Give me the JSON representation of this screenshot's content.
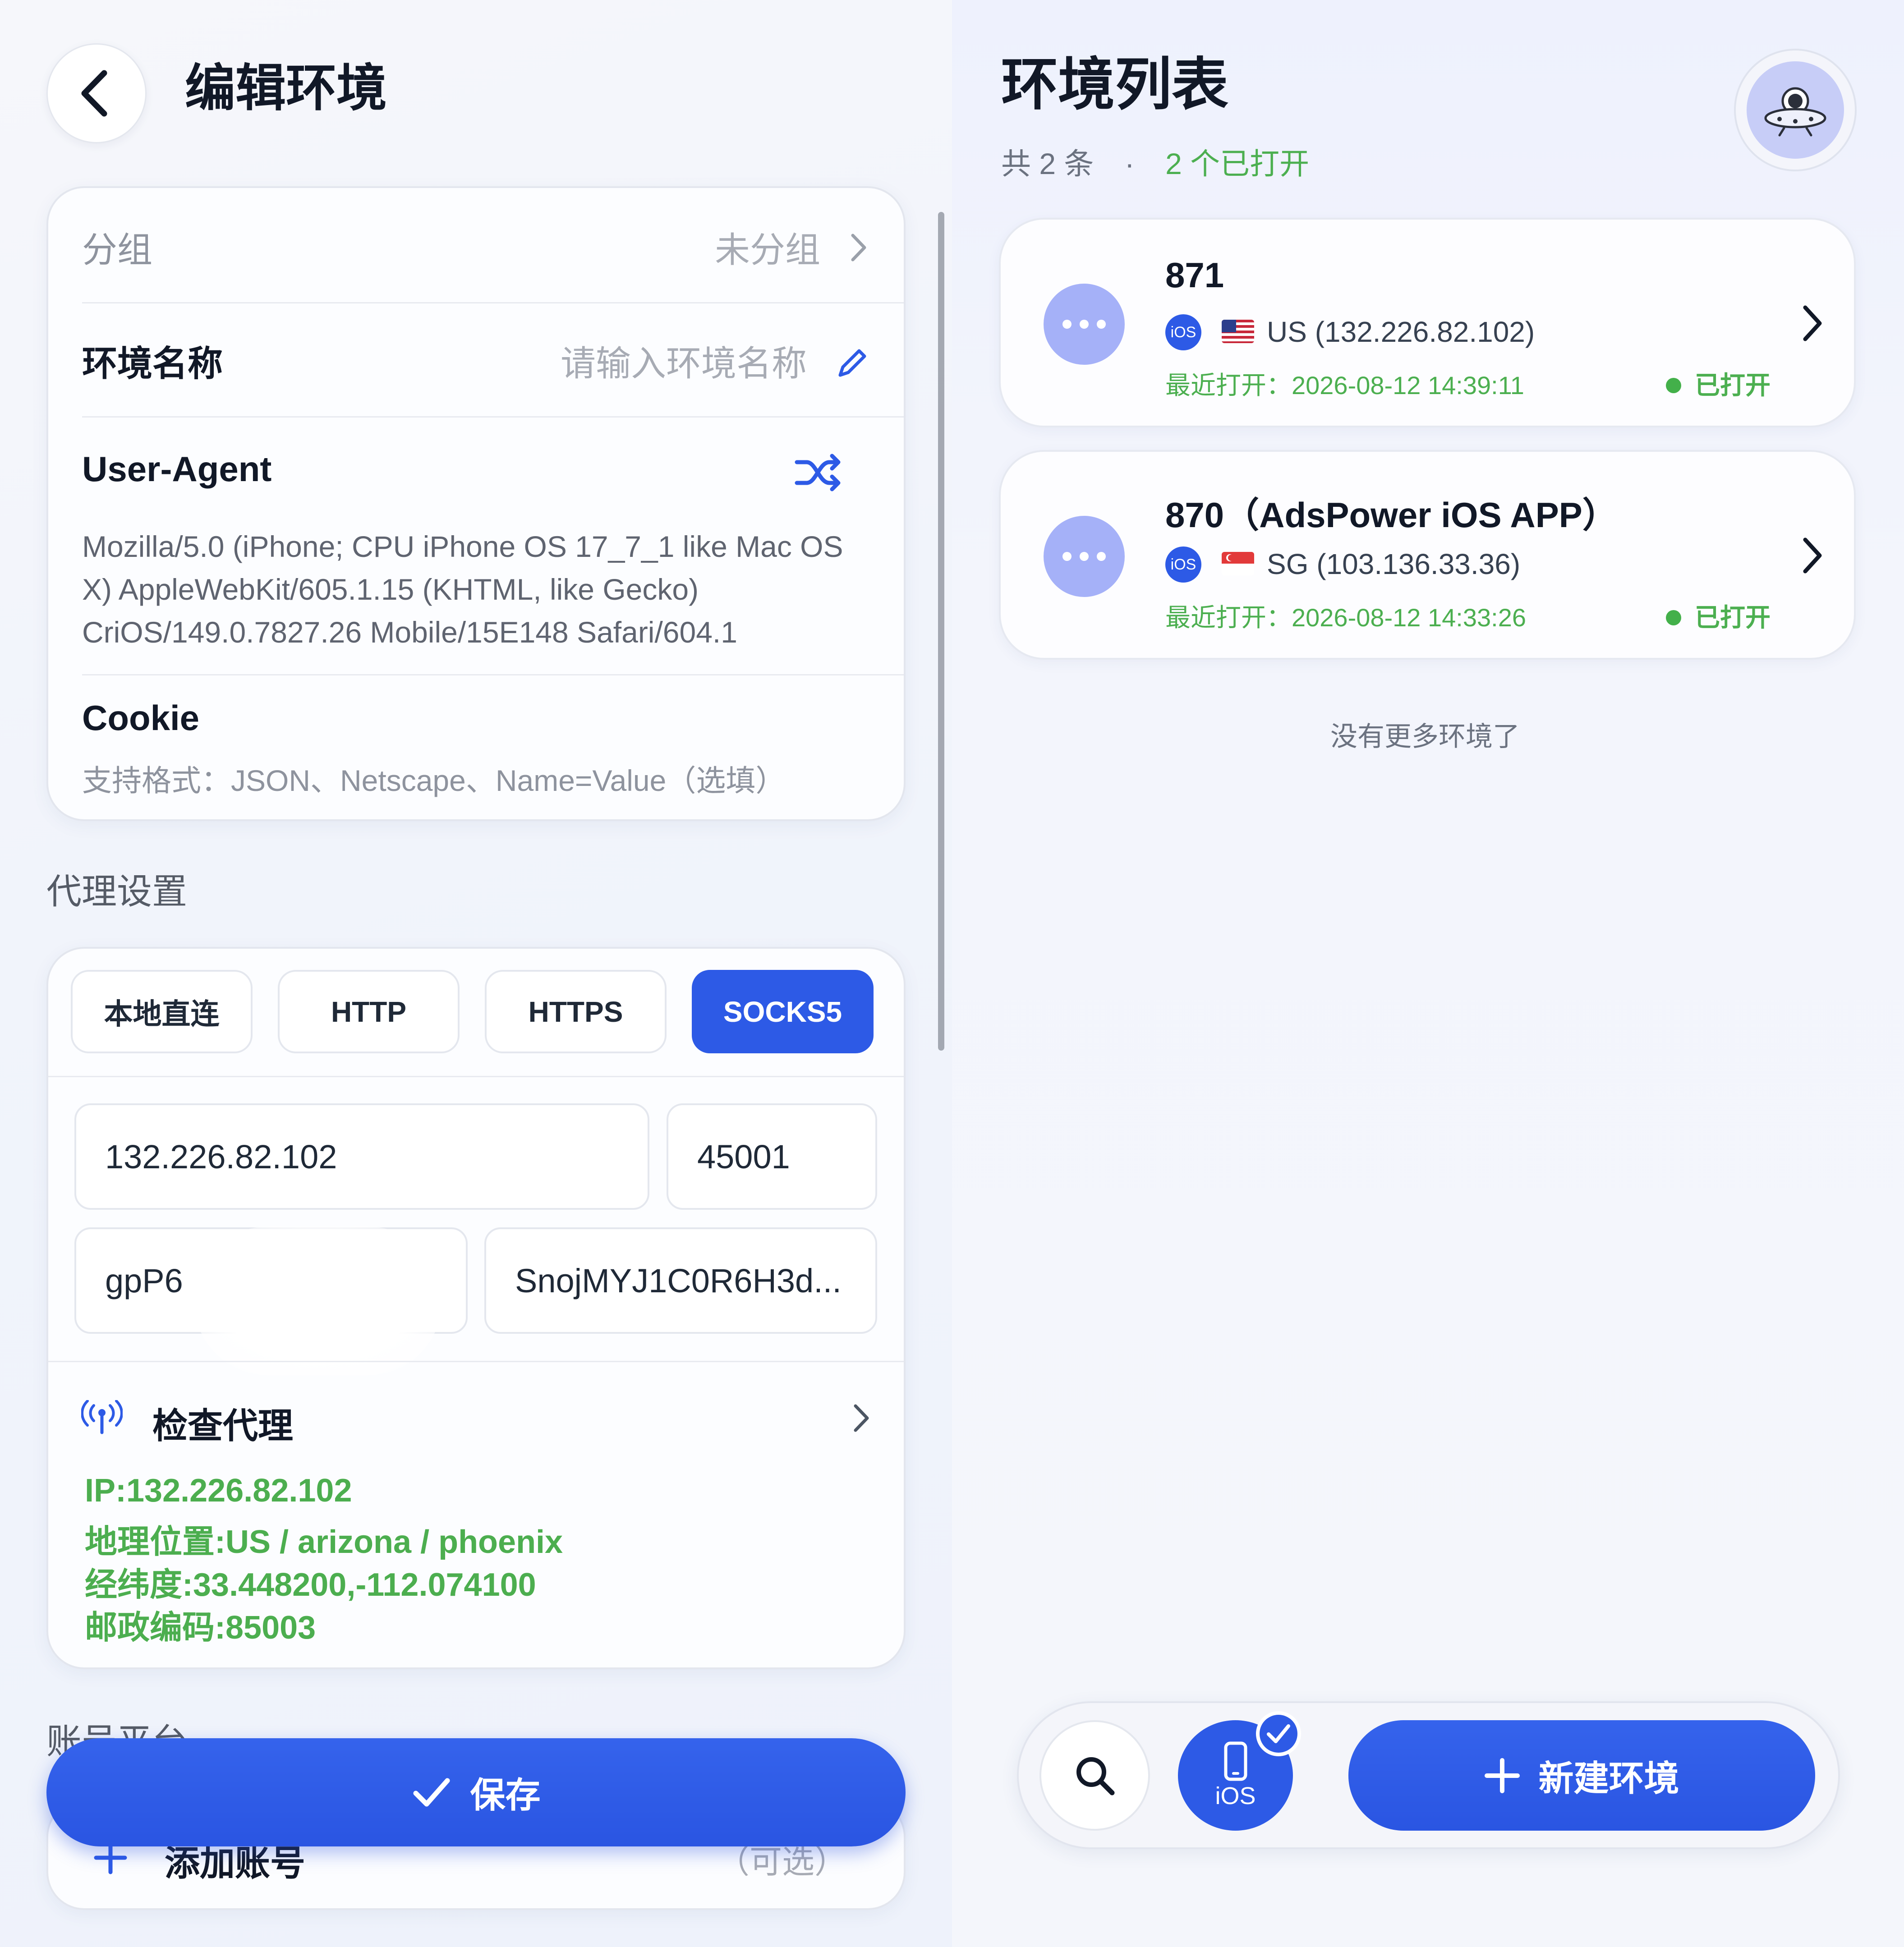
{
  "edit": {
    "title": "编辑环境",
    "group_label": "分组",
    "group_value": "未分组",
    "name_label": "环境名称",
    "name_placeholder": "请输入环境名称",
    "ua_label": "User-Agent",
    "ua_value": "Mozilla/5.0 (iPhone; CPU iPhone OS 17_7_1 like Mac OS X) AppleWebKit/605.1.15 (KHTML, like Gecko) CriOS/149.0.7827.26 Mobile/15E148 Safari/604.1",
    "cookie_label": "Cookie",
    "cookie_hint": "支持格式：JSON、Netscape、Name=Value（选填）"
  },
  "proxy": {
    "section_title": "代理设置",
    "types": [
      "本地直连",
      "HTTP",
      "HTTPS",
      "SOCKS5"
    ],
    "selected_type": "SOCKS5",
    "host": "132.226.82.102",
    "port": "45001",
    "username": "gpP6",
    "password": "SnojMYJ1C0R6H3d...",
    "check_label": "检查代理",
    "result": {
      "ip": "IP:132.226.82.102",
      "location": "地理位置:US / arizona / phoenix",
      "coords": "经纬度:33.448200,-112.074100",
      "postal": "邮政编码:85003"
    }
  },
  "account": {
    "section_title": "账号平台",
    "add_label": "添加账号",
    "optional": "（可选）"
  },
  "save_label": "保存",
  "list": {
    "title": "环境列表",
    "count_text": "共 2 条",
    "separator": "·",
    "open_text": "2 个已打开",
    "items": [
      {
        "name": "871",
        "badge": "iOS",
        "country_ip": "US (132.226.82.102)",
        "last_open": "最近打开：2026-08-12 14:39:11",
        "status": "已打开"
      },
      {
        "name": "870（AdsPower iOS APP）",
        "badge": "iOS",
        "country_ip": "SG (103.136.33.36)",
        "last_open": "最近打开：2026-08-12 14:33:26",
        "status": "已打开"
      }
    ],
    "no_more": "没有更多环境了"
  },
  "bottom_bar": {
    "ios_label": "iOS",
    "new_label": "新建环境"
  },
  "colors": {
    "accent": "#2d5ae6",
    "success": "#4caf50",
    "avatar_bg": "#a5b1f8"
  }
}
